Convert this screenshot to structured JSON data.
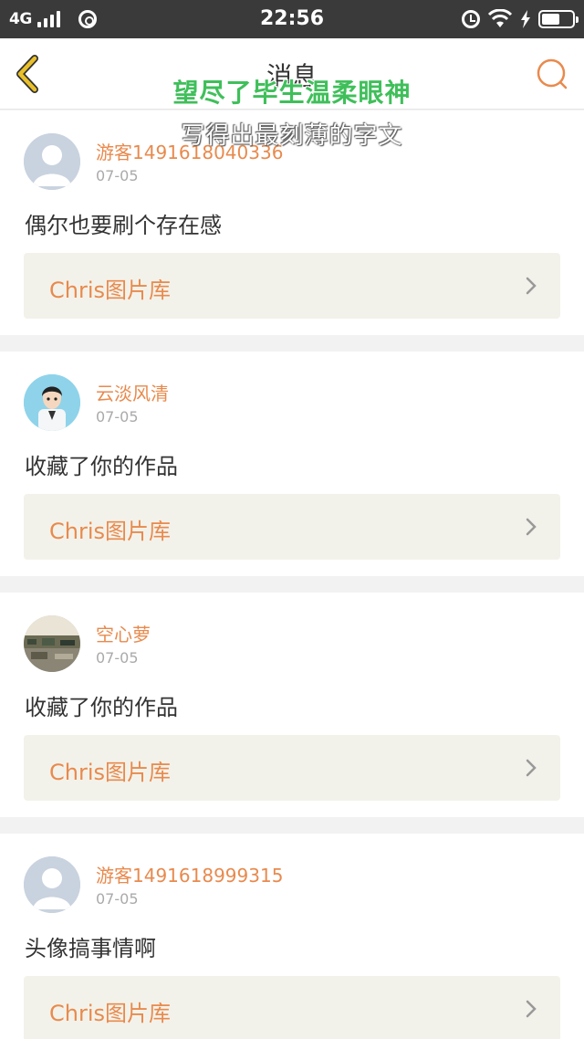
{
  "status_bar": {
    "network": "4G",
    "time": "22:56"
  },
  "nav": {
    "title": "消息"
  },
  "overlay": {
    "line1": "望尽了毕生温柔眼神",
    "line2": "写得出最刻薄的字文"
  },
  "messages": [
    {
      "username": "游客1491618040336",
      "date": "07-05",
      "text": "偶尔也要刷个存在感",
      "album": "Chris图片库",
      "avatar": "default-avatar-icon"
    },
    {
      "username": "云淡风清",
      "date": "07-05",
      "text": "收藏了你的作品",
      "album": "Chris图片库",
      "avatar": "cartoon-person-avatar"
    },
    {
      "username": "空心萝",
      "date": "07-05",
      "text": "收藏了你的作品",
      "album": "Chris图片库",
      "avatar": "street-photo-avatar"
    },
    {
      "username": "游客1491618999315",
      "date": "07-05",
      "text": "头像搞事情啊",
      "album": "Chris图片库",
      "avatar": "default-avatar-icon"
    }
  ],
  "colors": {
    "accent": "#e88a4d",
    "back_icon": "#e8c02a",
    "overlay_green": "#3fbf5a"
  }
}
